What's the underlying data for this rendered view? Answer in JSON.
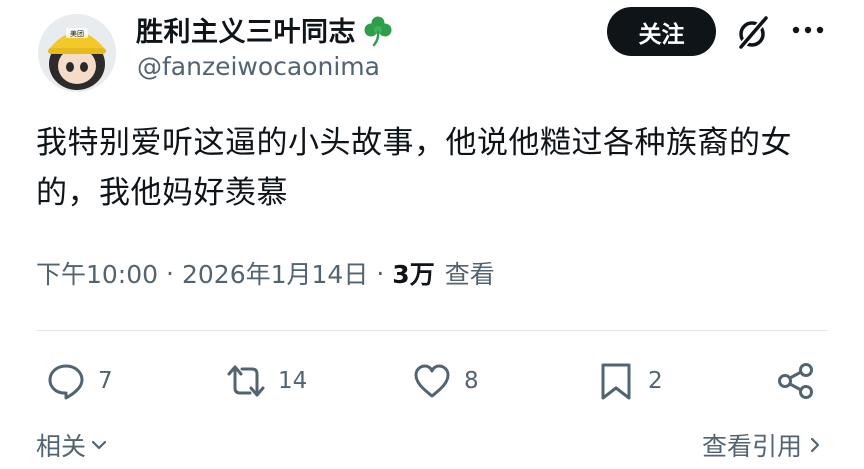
{
  "author": {
    "name": "胜利主义三叶同志",
    "handle": "@fanzeiwocaonima",
    "avatar_badge": "美团"
  },
  "header": {
    "follow_label": "关注"
  },
  "post": {
    "text": "我特别爱听这逼的小头故事，他说他糙过各种族裔的女的，我他妈好羡慕",
    "time": "下午10:00",
    "date": "2026年1月14日",
    "views_count": "3万",
    "views_label": "查看"
  },
  "actions": {
    "replies": "7",
    "reposts": "14",
    "likes": "8",
    "bookmarks": "2"
  },
  "footer": {
    "related_label": "相关",
    "quotes_label": "查看引用"
  },
  "icons": [
    "clover-icon",
    "grok-icon",
    "more-icon",
    "reply-icon",
    "repost-icon",
    "like-icon",
    "bookmark-icon",
    "share-icon",
    "chevron-down-icon",
    "chevron-right-icon"
  ],
  "colors": {
    "text": "#0f1419",
    "secondary": "#536471",
    "button_bg": "#0f1419",
    "clover": "#2f9e4a"
  }
}
